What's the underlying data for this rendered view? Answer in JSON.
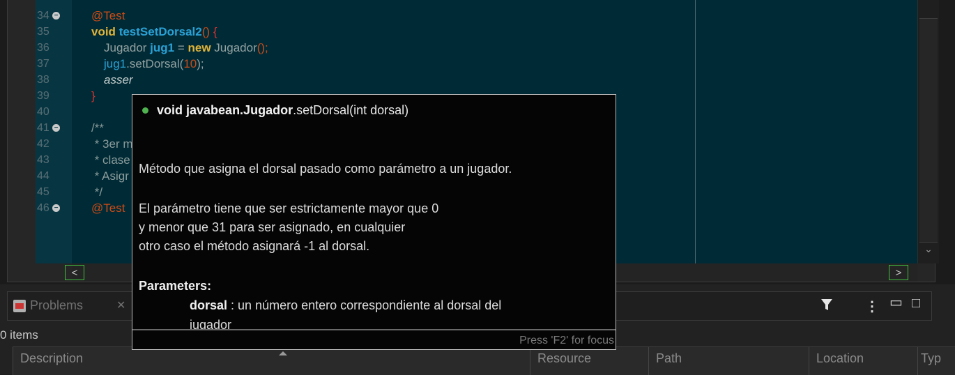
{
  "editor": {
    "lines": [
      {
        "n": "34",
        "fold": true
      },
      {
        "n": "35"
      },
      {
        "n": "36"
      },
      {
        "n": "37"
      },
      {
        "n": "38"
      },
      {
        "n": "39"
      },
      {
        "n": "40"
      },
      {
        "n": "41",
        "fold": true
      },
      {
        "n": "42"
      },
      {
        "n": "43"
      },
      {
        "n": "44"
      },
      {
        "n": "45"
      },
      {
        "n": "46",
        "fold": true
      }
    ],
    "code": {
      "l34_ann": "@Test",
      "l35_kw": "void",
      "l35_fn": "testSetDorsal2",
      "l35_paren": "()",
      "l35_brace": "{",
      "l36_type": "Jugador",
      "l36_var": "jug1",
      "l36_eq": " = ",
      "l36_new": "new",
      "l36_ctor": "Jugador",
      "l36_paren": "();",
      "l37_obj": "jug1",
      "l37_call": ".setDorsal(",
      "l37_num": "10",
      "l37_end": ");",
      "l38_assert": "asser",
      "l39_brace": "}",
      "l41_cmt": "/**",
      "l42_cmt": " * 3er m",
      "l43_cmt": " * clase",
      "l44_cmt": " * Asigr",
      "l45_cmt": " */",
      "l46_ann": "@Test"
    },
    "scroll_left": "<",
    "scroll_right": ">",
    "scroll_down": "⌄"
  },
  "popup": {
    "sig_prefix": "void ",
    "sig_class": "javabean.Jugador",
    "sig_method": ".setDorsal(int dorsal)",
    "desc": "Método que asigna el dorsal pasado como parámetro a un jugador.",
    "para1": "El parámetro tiene que ser estrictamente mayor que 0",
    "para2": "y menor que 31 para ser asignado, en cualquier",
    "para3": "otro caso el método asignará -1 al dorsal.",
    "params_heading": "Parameters:",
    "param_name": "dorsal",
    "param_desc": " : un número entero correspondiente al dorsal del",
    "param_desc2": "jugador",
    "footer": "Press 'F2' for focus"
  },
  "problems": {
    "tab_label": "Problems",
    "tab_close": "✕",
    "count": "0 items",
    "columns": [
      "Description",
      "Resource",
      "Path",
      "Location",
      "Typ"
    ],
    "filter_icon": "filter-icon",
    "menu_icon": "view-menu-icon",
    "minimize": "▭",
    "maximize": "□"
  }
}
